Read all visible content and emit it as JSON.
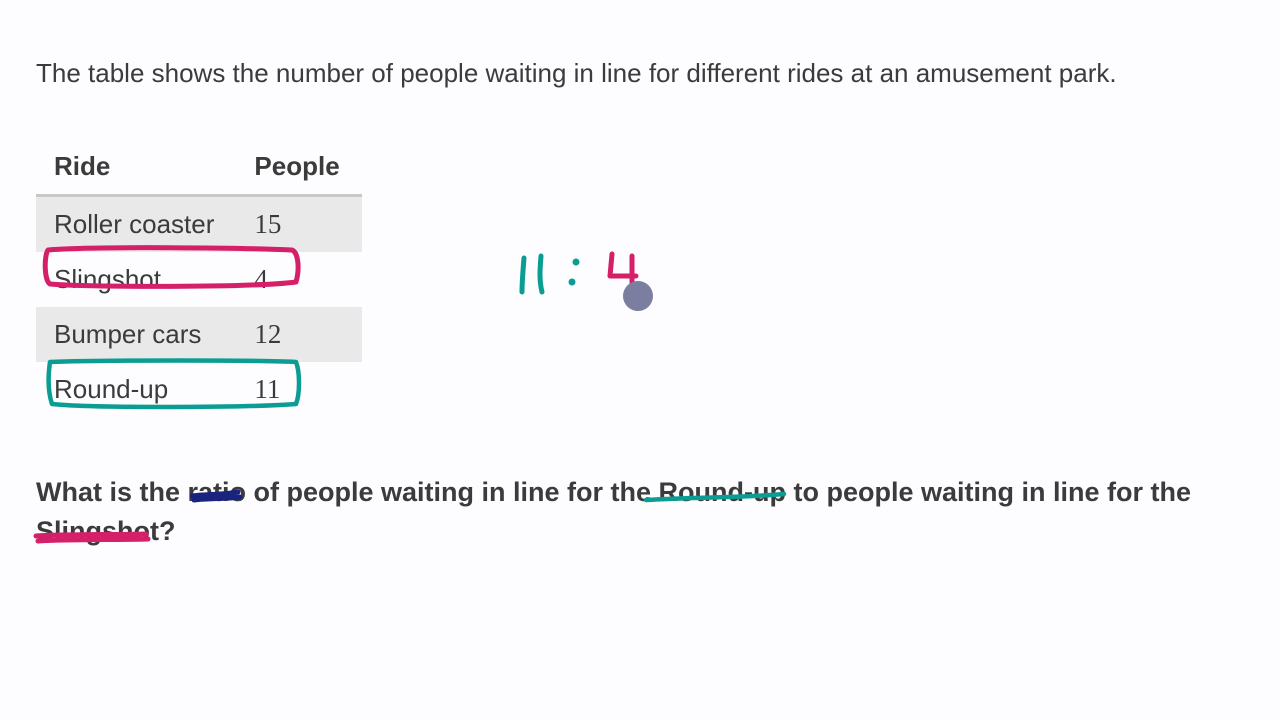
{
  "intro": "The table shows the number of people waiting in line for different rides at an amusement park.",
  "table": {
    "head": {
      "col1": "Ride",
      "col2": "People"
    },
    "rows": [
      {
        "ride": "Roller coaster",
        "people": "15"
      },
      {
        "ride": "Slingshot",
        "people": "4"
      },
      {
        "ride": "Bumper cars",
        "people": "12"
      },
      {
        "ride": "Round-up",
        "people": "11"
      }
    ]
  },
  "question": "What is the ratio of people waiting in line for the Round-up to people waiting in line for the Slingshot?",
  "annotations": {
    "ratio_left": "11",
    "ratio_colon": ":",
    "ratio_right": "4",
    "colors": {
      "teal": "#0b9d93",
      "pink": "#d61f69",
      "navy": "#1a237e",
      "dot": "#7b7e9e"
    }
  }
}
